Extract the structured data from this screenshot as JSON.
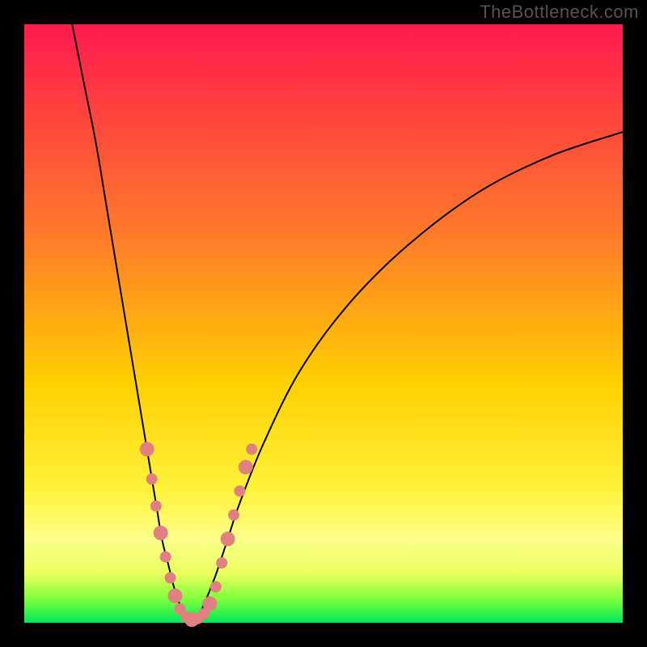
{
  "watermark": "TheBottleneck.com",
  "chart_data": {
    "type": "line",
    "title": "",
    "xlabel": "",
    "ylabel": "",
    "xlim": [
      0,
      100
    ],
    "ylim": [
      0,
      100
    ],
    "background_gradient": {
      "stops": [
        {
          "offset": 0.0,
          "color": "#ff1a4d"
        },
        {
          "offset": 0.35,
          "color": "#ff7a2a"
        },
        {
          "offset": 0.6,
          "color": "#ffd000"
        },
        {
          "offset": 0.78,
          "color": "#fff33b"
        },
        {
          "offset": 0.86,
          "color": "#fdff8a"
        },
        {
          "offset": 0.92,
          "color": "#e7ff5c"
        },
        {
          "offset": 0.96,
          "color": "#7fff3a"
        },
        {
          "offset": 1.0,
          "color": "#00e85a"
        }
      ]
    },
    "series": [
      {
        "name": "left-curve",
        "x": [
          8,
          10,
          12,
          14,
          16,
          18,
          20,
          22,
          23,
          24,
          25,
          26,
          27,
          28
        ],
        "y": [
          100,
          90,
          80,
          68,
          56,
          44,
          32,
          20,
          14,
          10,
          6,
          3,
          1,
          0
        ],
        "stroke": "#000000"
      },
      {
        "name": "right-curve",
        "x": [
          28,
          29,
          30,
          32,
          34,
          36,
          40,
          46,
          54,
          64,
          76,
          88,
          100
        ],
        "y": [
          0,
          1,
          3,
          8,
          14,
          20,
          30,
          42,
          53,
          63,
          72,
          78,
          82
        ],
        "stroke": "#000000"
      }
    ],
    "markers": {
      "color": "#e08080",
      "radius_min": 6,
      "radius_max": 9,
      "points": [
        {
          "x": 20.5,
          "y": 29
        },
        {
          "x": 21.3,
          "y": 24
        },
        {
          "x": 22.0,
          "y": 19.5
        },
        {
          "x": 22.8,
          "y": 15
        },
        {
          "x": 23.6,
          "y": 11
        },
        {
          "x": 24.4,
          "y": 7.5
        },
        {
          "x": 25.2,
          "y": 4.5
        },
        {
          "x": 26.0,
          "y": 2.3
        },
        {
          "x": 27.0,
          "y": 1.0
        },
        {
          "x": 28.0,
          "y": 0.5
        },
        {
          "x": 29.0,
          "y": 0.7
        },
        {
          "x": 30.0,
          "y": 1.5
        },
        {
          "x": 31.0,
          "y": 3.2
        },
        {
          "x": 32.0,
          "y": 6.0
        },
        {
          "x": 33.0,
          "y": 10.0
        },
        {
          "x": 34.0,
          "y": 14.0
        },
        {
          "x": 35.0,
          "y": 18.0
        },
        {
          "x": 36.0,
          "y": 22.0
        },
        {
          "x": 37.0,
          "y": 26.0
        },
        {
          "x": 38.0,
          "y": 29.0
        }
      ]
    }
  }
}
